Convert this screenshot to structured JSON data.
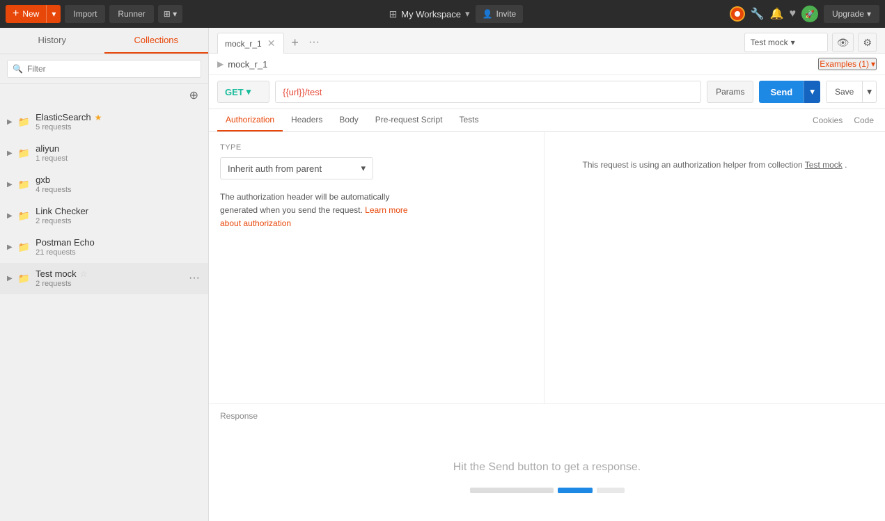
{
  "topbar": {
    "new_label": "New",
    "import_label": "Import",
    "runner_label": "Runner",
    "workspace_label": "My Workspace",
    "invite_label": "Invite",
    "upgrade_label": "Upgrade"
  },
  "sidebar": {
    "history_tab": "History",
    "collections_tab": "Collections",
    "filter_placeholder": "Filter",
    "collections": [
      {
        "name": "ElasticSearch",
        "count": "5 requests",
        "starred": true,
        "id": "elasticsearch"
      },
      {
        "name": "aliyun",
        "count": "1 request",
        "starred": false,
        "id": "aliyun"
      },
      {
        "name": "gxb",
        "count": "4 requests",
        "starred": false,
        "id": "gxb"
      },
      {
        "name": "Link Checker",
        "count": "2 requests",
        "starred": false,
        "id": "link-checker"
      },
      {
        "name": "Postman Echo",
        "count": "21 requests",
        "starred": false,
        "id": "postman-echo"
      },
      {
        "name": "Test mock",
        "count": "2 requests",
        "starred": false,
        "id": "test-mock"
      }
    ]
  },
  "tab": {
    "name": "mock_r_1"
  },
  "breadcrumb": {
    "name": "mock_r_1"
  },
  "request": {
    "method": "GET",
    "method_arrow": "▾",
    "url": "{{url}}/test",
    "params_label": "Params",
    "send_label": "Send",
    "save_label": "Save"
  },
  "environment": {
    "selected": "Test mock",
    "arrow": "▾"
  },
  "examples": {
    "label": "Examples (1)",
    "arrow": "▾"
  },
  "request_tabs": {
    "items": [
      "Authorization",
      "Headers",
      "Body",
      "Pre-request Script",
      "Tests"
    ],
    "active": "Authorization",
    "extras": [
      "Cookies",
      "Code"
    ]
  },
  "authorization": {
    "type_label": "TYPE",
    "selected_type": "Inherit auth from parent",
    "arrow": "▾",
    "description": "The authorization header will be automatically generated when you send the request.",
    "link_text": "Learn more about authorization",
    "helper_text": "This request is using an authorization helper from collection",
    "helper_link": "Test mock",
    "helper_period": "."
  },
  "response": {
    "label": "Response",
    "message": "Hit the Send button to get a response."
  },
  "response_graphic": {
    "bar1_width": 120,
    "bar2_width": 50,
    "bar3_width": 40
  }
}
